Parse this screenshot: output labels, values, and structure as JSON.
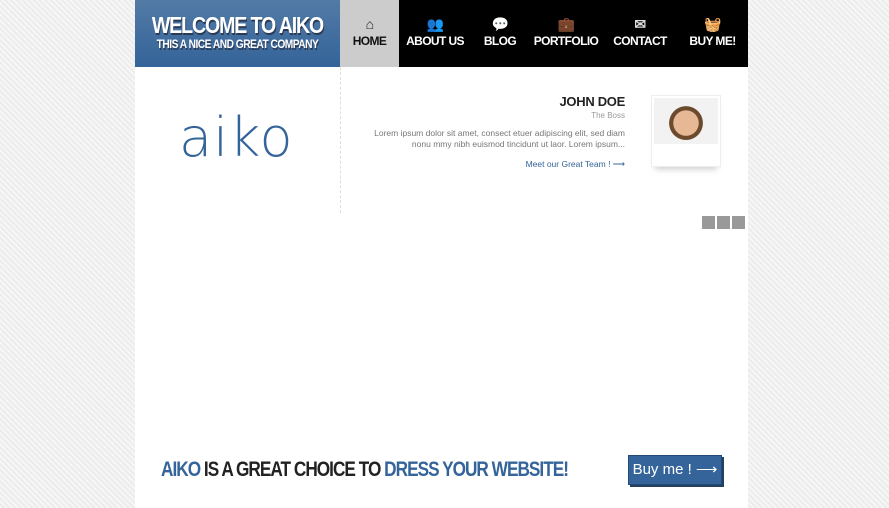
{
  "header": {
    "title": "WELCOME TO AIKO",
    "subtitle": "THIS A NICE AND GREAT COMPANY"
  },
  "nav": [
    {
      "label": "HOME",
      "icon": "home-icon",
      "glyph": "⌂",
      "active": true
    },
    {
      "label": "ABOUT US",
      "icon": "users-icon",
      "glyph": "👥"
    },
    {
      "label": "BLOG",
      "icon": "chat-bubbles-icon",
      "glyph": "💬"
    },
    {
      "label": "PORTFOLIO",
      "icon": "briefcase-icon",
      "glyph": "💼"
    },
    {
      "label": "CONTACT",
      "icon": "envelope-icon",
      "glyph": "✉"
    },
    {
      "label": "BUY ME!",
      "icon": "basket-icon",
      "glyph": "🧺"
    }
  ],
  "logo": "aiko",
  "team": {
    "name": "JOHN DOE",
    "role": "The Boss",
    "description": "Lorem ipsum dolor sit amet, consect etuer adipiscing elit, sed diam nonu mmy nibh euismod tincidunt ut laor. Lorem ipsum...",
    "link": "Meet our Great Team ! ⟶"
  },
  "tagline": {
    "p1": "AIKO",
    "p2": " IS A GREAT CHOICE TO ",
    "p3": "DRESS YOUR WEBSITE!"
  },
  "cta": "Buy me ! ⟶",
  "colors": {
    "accent": "#34649a",
    "nav_bg": "#000000",
    "active_tab": "#cccccc"
  }
}
